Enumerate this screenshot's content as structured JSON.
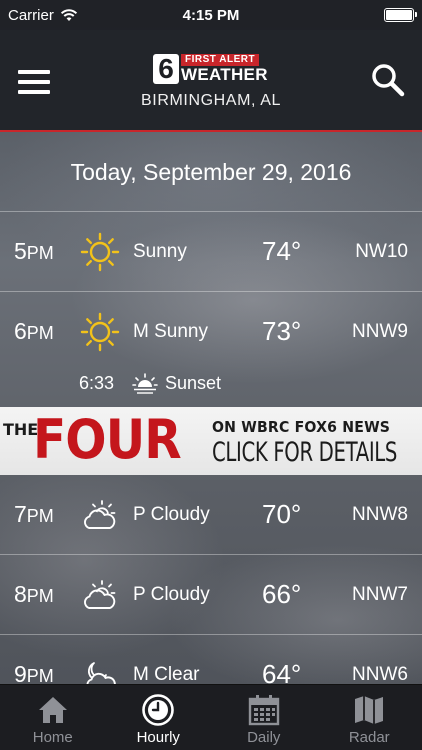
{
  "status_bar": {
    "carrier": "Carrier",
    "time": "4:15 PM",
    "battery_level": 1.0
  },
  "header": {
    "logo_number": "6",
    "logo_tag": "FIRST ALERT",
    "logo_title": "WEATHER",
    "location": "BIRMINGHAM, AL",
    "menu_icon": "hamburger-menu-icon",
    "search_icon": "search-icon"
  },
  "date_label": "Today, September 29, 2016",
  "hours": [
    {
      "hour": "5",
      "ampm": "PM",
      "icon": "sun-icon",
      "condition": "Sunny",
      "temp": "74°",
      "wind": "NW10"
    },
    {
      "hour": "6",
      "ampm": "PM",
      "icon": "sun-icon",
      "condition": "M Sunny",
      "temp": "73°",
      "wind": "NNW9"
    },
    {
      "hour": "7",
      "ampm": "PM",
      "icon": "partly-cloudy-icon",
      "condition": "P Cloudy",
      "temp": "70°",
      "wind": "NNW8"
    },
    {
      "hour": "8",
      "ampm": "PM",
      "icon": "partly-cloudy-icon",
      "condition": "P Cloudy",
      "temp": "66°",
      "wind": "NNW7"
    },
    {
      "hour": "9",
      "ampm": "PM",
      "icon": "moon-cloud-icon",
      "condition": "M Clear",
      "temp": "64°",
      "wind": "NNW6"
    }
  ],
  "sunset": {
    "time": "6:33",
    "label": "Sunset",
    "icon": "sunset-icon"
  },
  "ad": {
    "the": "THE",
    "four": "FOUR",
    "line1": "ON WBRC FOX6 NEWS",
    "line2": "CLICK FOR DETAILS"
  },
  "tabs": [
    {
      "label": "Home",
      "icon": "home-icon",
      "active": false
    },
    {
      "label": "Hourly",
      "icon": "clock-icon",
      "active": true
    },
    {
      "label": "Daily",
      "icon": "calendar-icon",
      "active": false
    },
    {
      "label": "Radar",
      "icon": "map-icon",
      "active": false
    }
  ],
  "colors": {
    "accent_red": "#c8262b",
    "sun_yellow": "#f2c21a",
    "tab_inactive": "#8f9197"
  }
}
